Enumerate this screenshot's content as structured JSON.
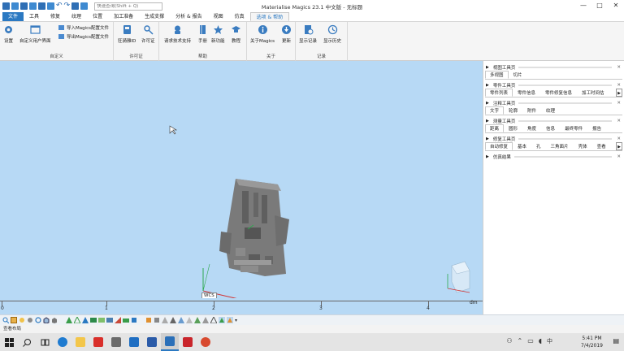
{
  "window": {
    "title": "Materialise Magics 23.1 中文版 - 无标题",
    "search_placeholder": "快速查询(Shift + Q)",
    "minimize": "—",
    "maximize": "□",
    "close": "✕"
  },
  "tabs": [
    {
      "label": "文件"
    },
    {
      "label": "工具"
    },
    {
      "label": "修复"
    },
    {
      "label": "纹理"
    },
    {
      "label": "位置"
    },
    {
      "label": "加工准备"
    },
    {
      "label": "生成支撑"
    },
    {
      "label": "分析 & 报告"
    },
    {
      "label": "视图"
    },
    {
      "label": "仿真"
    },
    {
      "label": "选项 & 帮助"
    }
  ],
  "ribbon": {
    "custom": {
      "label": "自定义",
      "settings": "设置",
      "custom_ui": "自定义用户界面",
      "import_cfg": "导入Magics配置文件",
      "export_cfg": "导出Magics配置文件"
    },
    "license": {
      "label": "许可证",
      "dongle": "狂骑雅ID",
      "license": "许可证"
    },
    "help": {
      "label": "帮助",
      "support": "请求技术支持",
      "manual": "手册",
      "new_features": "新功能",
      "tutorial": "教程"
    },
    "about": {
      "label": "关于",
      "about_magics": "关于Magics",
      "update": "更新"
    },
    "log": {
      "label": "记录",
      "show_log": "显示记录",
      "show_history": "显示历史"
    }
  },
  "panel": {
    "view_toolpage": "视图工具页",
    "view_tabs": [
      "多视图",
      "切片"
    ],
    "part_toolpage": "零件工具页",
    "part_tabs": [
      "零件列表",
      "零件信息",
      "零件修复信息",
      "加工时间估"
    ],
    "annot_toolpage": "注释工具页",
    "annot_tabs": [
      "文字",
      "轮廓",
      "附件",
      "纹理"
    ],
    "measure_toolpage": "测量工具页",
    "measure_tabs": [
      "距离",
      "圆形",
      "角度",
      "信息",
      "最终零件",
      "报告"
    ],
    "fix_toolpage": "修复工具页",
    "fix_tabs": [
      "自动修复",
      "基本",
      "孔",
      "三角面片",
      "壳体",
      "查看"
    ],
    "sim_results": "仿真结果"
  },
  "ruler": {
    "ticks": [
      "0",
      "1",
      "2",
      "3",
      "4"
    ],
    "unit": "dm"
  },
  "viewport": {
    "wcs_label": "WCS",
    "background": "#b7d9f5"
  },
  "status": {
    "text": "查看布局"
  },
  "taskbar": {
    "time": "5:41 PM",
    "date": "7/4/2019",
    "ime": "中"
  },
  "colors": {
    "accent": "#2b79c2",
    "viewport": "#b7d9f5",
    "part": "#7a7a7a"
  }
}
